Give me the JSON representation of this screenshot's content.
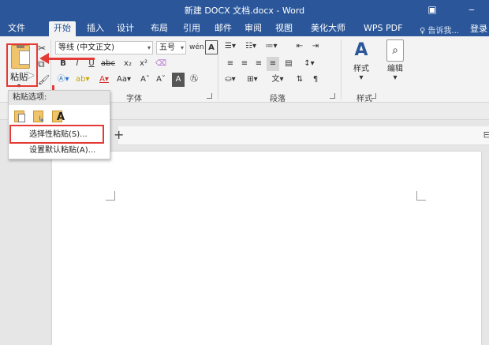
{
  "window": {
    "title": "新建 DOCX 文档.docx - Word",
    "restore_icon": "restore-icon",
    "minimize_icon": "minimize-icon"
  },
  "tabs": [
    {
      "label": "文件",
      "active": false
    },
    {
      "label": "开始",
      "active": true
    },
    {
      "label": "插入",
      "active": false
    },
    {
      "label": "设计",
      "active": false
    },
    {
      "label": "布局",
      "active": false
    },
    {
      "label": "引用",
      "active": false
    },
    {
      "label": "邮件",
      "active": false
    },
    {
      "label": "审阅",
      "active": false
    },
    {
      "label": "视图",
      "active": false
    },
    {
      "label": "美化大师",
      "active": false
    },
    {
      "label": "WPS PDF",
      "active": false
    }
  ],
  "tell_me": "告诉我...",
  "login": "登录",
  "ribbon": {
    "paste_label": "粘贴",
    "font_name": "等线 (中文正文)",
    "font_size": "五号",
    "font_group_label": "字体",
    "paragraph_group_label": "段落",
    "styles_label": "样式",
    "styles_group_label": "样式",
    "edit_label": "编辑",
    "wen_glyph": "wén",
    "aa_glyph": "Aa"
  },
  "paste_menu": {
    "header": "粘贴选项:",
    "items": [
      "选择性粘贴(S)...",
      "设置默认粘贴(A)..."
    ]
  },
  "doc_tab": {
    "add_symbol": "+"
  },
  "colors": {
    "accent": "#2b579a",
    "highlight_red": "#e53935",
    "ribbon_bg": "#f3f3f3"
  }
}
